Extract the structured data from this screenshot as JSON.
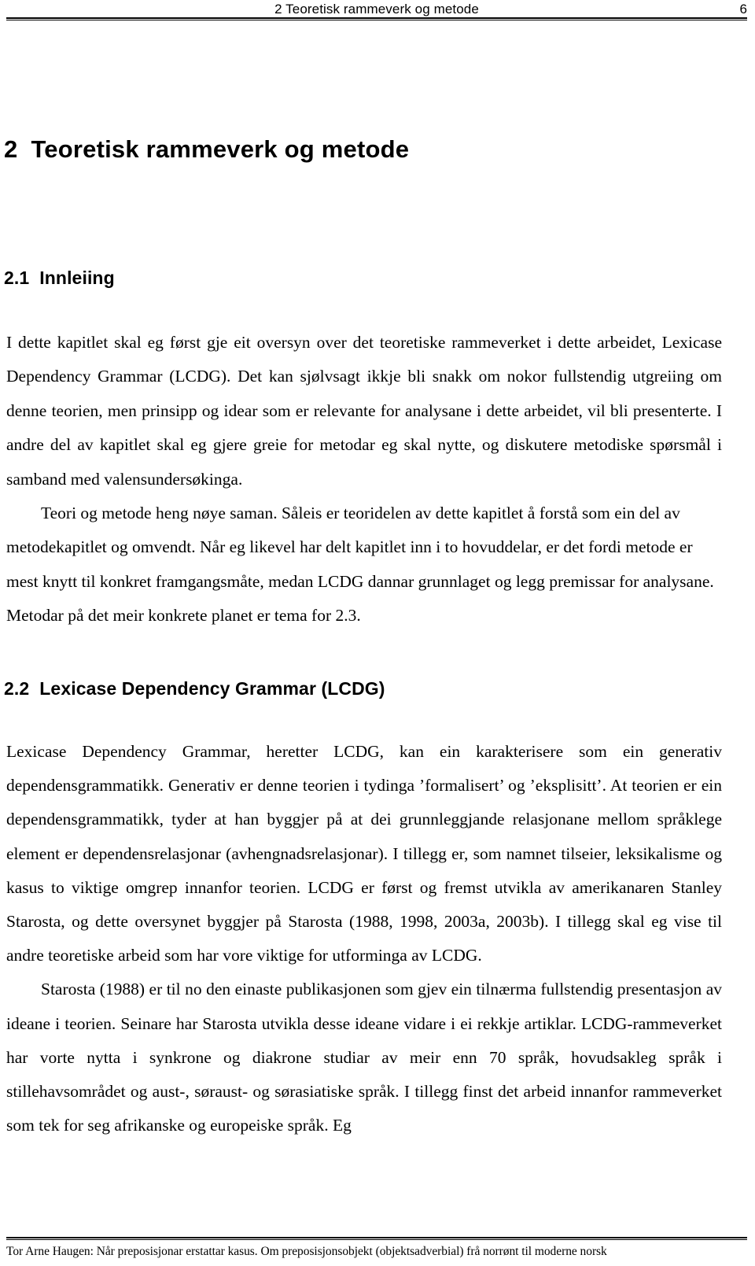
{
  "header": {
    "title": "2 Teoretisk rammeverk og metode",
    "page_number": "6"
  },
  "chapter": {
    "number": "2",
    "title": "Teoretisk rammeverk og metode"
  },
  "sections": [
    {
      "number": "2.1",
      "title": "Innleiing",
      "paragraphs": [
        "I dette kapitlet skal eg først gje eit oversyn over det teoretiske rammeverket i dette arbeidet, Lexicase Dependency Grammar (LCDG). Det kan sjølvsagt ikkje bli snakk om nokor fullstendig utgreiing om denne teorien, men prinsipp og idear som er relevante for analysane i dette arbeidet, vil bli presenterte. I andre del av kapitlet skal eg gjere greie for metodar eg skal nytte, og diskutere metodiske spørsmål i samband med valensundersøkinga.",
        "Teori og metode heng nøye saman. Såleis er teoridelen av dette kapitlet å forstå som ein del av metodekapitlet og omvendt. Når eg likevel har delt kapitlet inn i to hovuddelar, er det fordi metode er mest knytt til konkret framgangsmåte, medan LCDG dannar grunnlaget og legg premissar for analysane. Metodar på det meir konkrete planet er tema for 2.3."
      ]
    },
    {
      "number": "2.2",
      "title": "Lexicase Dependency Grammar (LCDG)",
      "paragraphs": [
        "Lexicase Dependency Grammar, heretter LCDG, kan ein karakterisere som ein generativ dependensgrammatikk. Generativ er denne teorien i tydinga ’formalisert’ og ’eksplisitt’. At teorien er ein dependensgrammatikk, tyder at han byggjer på at dei grunnleggjande relasjonane mellom språklege element er dependensrelasjonar (avhengnadsrelasjonar). I tillegg er, som namnet tilseier, leksikalisme og kasus to viktige omgrep innanfor teorien. LCDG er først og fremst utvikla av amerikanaren Stanley Starosta, og dette oversynet byggjer på Starosta (1988, 1998, 2003a, 2003b). I tillegg skal eg vise til andre teoretiske arbeid som har vore viktige for utforminga av LCDG.",
        "Starosta (1988) er til no den einaste publikasjonen som gjev ein tilnærma fullstendig presentasjon av ideane i teorien. Seinare har Starosta utvikla desse ideane vidare i ei rekkje artiklar. LCDG-rammeverket har vorte nytta i synkrone og diakrone studiar av meir enn 70 språk, hovudsakleg språk i stillehavsområdet og aust-, søraust- og sørasiatiske språk. I tillegg finst det arbeid innanfor rammeverket som tek for seg afrikanske og europeiske språk. Eg"
      ]
    }
  ],
  "footer": {
    "text": "Tor Arne Haugen: Når preposisjonar erstattar kasus. Om preposisjonsobjekt (objektsadverbial) frå norrønt til moderne norsk"
  },
  "colors": {
    "text": "#000000",
    "background": "#ffffff"
  }
}
